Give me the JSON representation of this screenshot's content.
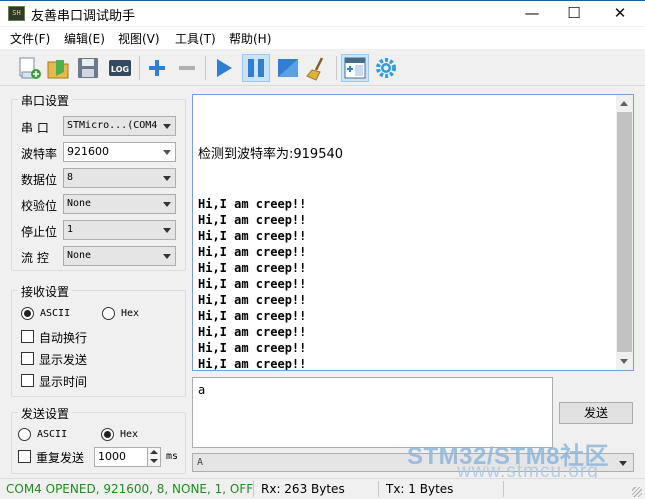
{
  "window": {
    "title": "友善串口调试助手",
    "app_icon_text": "SH",
    "minimize": "—",
    "maximize": "☐",
    "close": "✕"
  },
  "menu": [
    "文件(F)",
    "编辑(E)",
    "视图(V)",
    "工具(T)",
    "帮助(H)"
  ],
  "toolbar": {
    "icons": [
      "new-icon",
      "open-icon",
      "save-icon",
      "log-icon",
      "add-icon",
      "remove-icon",
      "play-icon",
      "pause-icon",
      "stop-icon",
      "clear-icon",
      "layout-icon",
      "settings-icon"
    ],
    "log_label": "LOG"
  },
  "serial_settings": {
    "title": "串口设置",
    "port_label": "串  口",
    "port_value": "STMicro...(COM4",
    "baud_label": "波特率",
    "baud_value": "921600",
    "databits_label": "数据位",
    "databits_value": "8",
    "parity_label": "校验位",
    "parity_value": "None",
    "stopbits_label": "停止位",
    "stopbits_value": "1",
    "flow_label": "流  控",
    "flow_value": "None"
  },
  "receive_settings": {
    "title": "接收设置",
    "ascii_label": "ASCII",
    "hex_label": "Hex",
    "mode": "ASCII",
    "auto_wrap_label": "自动换行",
    "show_send_label": "显示发送",
    "show_time_label": "显示时间"
  },
  "send_settings": {
    "title": "发送设置",
    "ascii_label": "ASCII",
    "hex_label": "Hex",
    "mode": "Hex",
    "repeat_label": "重复发送",
    "interval_value": "1000",
    "interval_unit": "ms"
  },
  "receive": {
    "first_line": "检测到波特率为:919540",
    "lines": [
      "Hi,I am creep!!",
      "Hi,I am creep!!",
      "Hi,I am creep!!",
      "Hi,I am creep!!",
      "Hi,I am creep!!",
      "Hi,I am creep!!",
      "Hi,I am creep!!",
      "Hi,I am creep!!",
      "Hi,I am creep!!",
      "Hi,I am creep!!",
      "Hi,I am creep!!",
      "Hi,I am creep!!",
      "Hi,I am creep!!",
      "Hi,I am creep!!"
    ]
  },
  "send": {
    "text": "a",
    "button": "发送",
    "history_value": "A"
  },
  "status": {
    "port": "COM4 OPENED, 921600, 8, NONE, 1, OFF",
    "port_color": "#1e8c1e",
    "rx": "Rx: 263 Bytes",
    "tx": "Tx: 1 Bytes"
  },
  "watermark": {
    "line1": "STM32/STM8社区",
    "line2": "www.stmcu.org"
  }
}
